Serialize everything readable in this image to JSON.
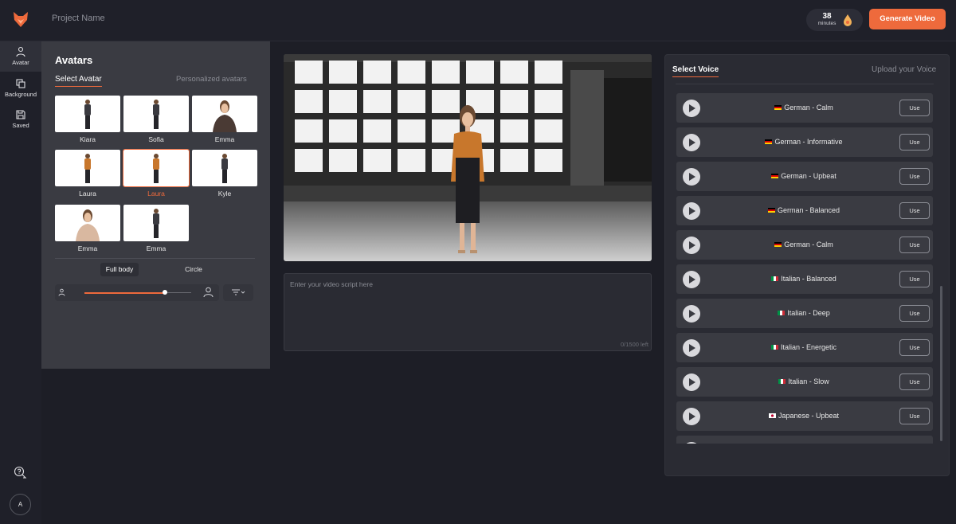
{
  "header": {
    "project_name": "Project Name",
    "minutes_value": "38",
    "minutes_label": "minutes",
    "generate_label": "Generate Video"
  },
  "rail": {
    "items": [
      {
        "label": "Avatar",
        "icon": "person-icon"
      },
      {
        "label": "Background",
        "icon": "layers-icon"
      },
      {
        "label": "Saved",
        "icon": "save-icon"
      }
    ],
    "user_initial": "A"
  },
  "avatars": {
    "title": "Avatars",
    "tab_select": "Select Avatar",
    "tab_personalized": "Personalized avatars",
    "items": [
      {
        "name": "Kiara"
      },
      {
        "name": "Sofia"
      },
      {
        "name": "Emma"
      },
      {
        "name": "Laura"
      },
      {
        "name": "Laura",
        "selected": true
      },
      {
        "name": "Kyle"
      },
      {
        "name": "Emma"
      },
      {
        "name": "Emma"
      }
    ],
    "shape_full_body": "Full body",
    "shape_circle": "Circle",
    "size_level": 0.75
  },
  "script": {
    "placeholder": "Enter your video script here",
    "char_count": "0/1500 left"
  },
  "voice": {
    "tab_select": "Select Voice",
    "tab_upload": "Upload your Voice",
    "use_label": "Use",
    "items": [
      {
        "name": "German - Calm",
        "flag": "de"
      },
      {
        "name": "German - Informative",
        "flag": "de"
      },
      {
        "name": "German - Upbeat",
        "flag": "de"
      },
      {
        "name": "German - Balanced",
        "flag": "de"
      },
      {
        "name": "German - Calm",
        "flag": "de"
      },
      {
        "name": "Italian - Balanced",
        "flag": "it"
      },
      {
        "name": "Italian - Deep",
        "flag": "it"
      },
      {
        "name": "Italian - Energetic",
        "flag": "it"
      },
      {
        "name": "Italian - Slow",
        "flag": "it"
      },
      {
        "name": "Japanese - Upbeat",
        "flag": "jp"
      }
    ]
  },
  "colors": {
    "accent": "#ee6a3c",
    "background": "#1d1e26",
    "panel": "#3a3b42"
  }
}
